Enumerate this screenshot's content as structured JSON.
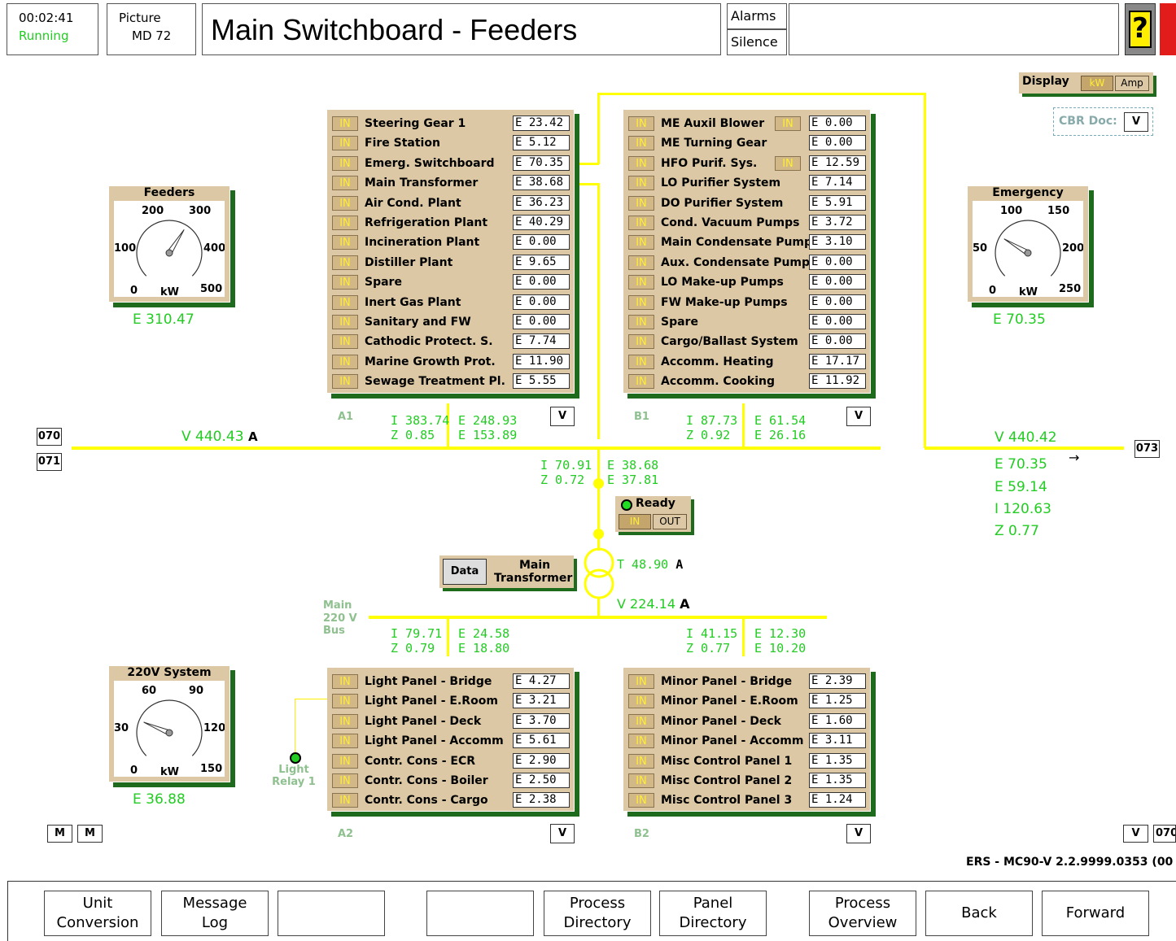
{
  "header": {
    "time": "00:02:41",
    "state": "Running",
    "picture_label": "Picture",
    "picture_id": "MD 72",
    "title": "Main Switchboard - Feeders",
    "alarms_label": "Alarms",
    "silence_label": "Silence",
    "help_glyph": "?"
  },
  "display": {
    "label": "Display",
    "kw": "kW",
    "amp": "Amp",
    "cbr_label": "CBR Doc:",
    "cbr_value": "V"
  },
  "in_label": "IN",
  "panel_a1": {
    "id": "A1",
    "rows": [
      {
        "label": "Steering Gear 1",
        "value": "E 23.42"
      },
      {
        "label": "Fire Station",
        "value": "E 5.12"
      },
      {
        "label": "Emerg. Switchboard",
        "value": "E 70.35"
      },
      {
        "label": "Main Transformer",
        "value": "E 38.68"
      },
      {
        "label": "Air Cond. Plant",
        "value": "E 36.23"
      },
      {
        "label": "Refrigeration Plant",
        "value": "E 40.29"
      },
      {
        "label": "Incineration Plant",
        "value": "E 0.00"
      },
      {
        "label": "Distiller Plant",
        "value": "E 9.65"
      },
      {
        "label": "Spare",
        "value": "E 0.00"
      },
      {
        "label": "Inert Gas Plant",
        "value": "E 0.00"
      },
      {
        "label": "Sanitary and FW",
        "value": "E 0.00"
      },
      {
        "label": "Cathodic Protect. S.",
        "value": "E 7.74"
      },
      {
        "label": "Marine Growth Prot.",
        "value": "E 11.90"
      },
      {
        "label": "Sewage Treatment Pl.",
        "value": "E 5.55"
      }
    ],
    "i": "I 383.74",
    "z": "Z 0.85",
    "e1": "E 248.93",
    "e2": "E 153.89",
    "v_btn": "V"
  },
  "panel_b1": {
    "id": "B1",
    "rows": [
      {
        "label": "ME Auxil Blower",
        "value": "E 0.00",
        "extra_in": true
      },
      {
        "label": "ME Turning Gear",
        "value": "E 0.00"
      },
      {
        "label": "HFO Purif. Sys.",
        "value": "E 12.59",
        "extra_in": true
      },
      {
        "label": "LO Purifier System",
        "value": "E 7.14"
      },
      {
        "label": "DO Purifier System",
        "value": "E 5.91"
      },
      {
        "label": "Cond. Vacuum Pumps",
        "value": "E 3.72"
      },
      {
        "label": "Main Condensate Pump",
        "value": "E 3.10"
      },
      {
        "label": "Aux. Condensate Pump",
        "value": "E 0.00"
      },
      {
        "label": "LO Make-up Pumps",
        "value": "E 0.00"
      },
      {
        "label": "FW Make-up Pumps",
        "value": "E 0.00"
      },
      {
        "label": "Spare",
        "value": "E 0.00"
      },
      {
        "label": "Cargo/Ballast System",
        "value": "E 0.00"
      },
      {
        "label": "Accomm. Heating",
        "value": "E 17.17"
      },
      {
        "label": "Accomm. Cooking",
        "value": "E 11.92"
      }
    ],
    "i": "I 87.73",
    "z": "Z 0.92",
    "e1": "E 61.54",
    "e2": "E 26.16",
    "v_btn": "V"
  },
  "panel_a2": {
    "id": "A2",
    "rows": [
      {
        "label": "Light Panel - Bridge",
        "value": "E 4.27"
      },
      {
        "label": "Light Panel - E.Room",
        "value": "E 3.21"
      },
      {
        "label": "Light Panel - Deck",
        "value": "E 3.70"
      },
      {
        "label": "Light Panel - Accomm",
        "value": "E 5.61"
      },
      {
        "label": "Contr.  Cons  - ECR",
        "value": "E 2.90"
      },
      {
        "label": "Contr.  Cons  - Boiler",
        "value": "E 2.50"
      },
      {
        "label": "Contr.  Cons  - Cargo",
        "value": "E 2.38"
      }
    ],
    "i": "I 79.71",
    "z": "Z 0.79",
    "e1": "E 24.58",
    "e2": "E 18.80",
    "v_btn": "V"
  },
  "panel_b2": {
    "id": "B2",
    "rows": [
      {
        "label": "Minor Panel - Bridge",
        "value": "E 2.39"
      },
      {
        "label": "Minor Panel - E.Room",
        "value": "E 1.25"
      },
      {
        "label": "Minor Panel - Deck",
        "value": "E 1.60"
      },
      {
        "label": "Minor Panel - Accomm",
        "value": "E 3.11"
      },
      {
        "label": "Misc Control Panel 1",
        "value": "E 1.35"
      },
      {
        "label": "Misc Control Panel 2",
        "value": "E 1.35"
      },
      {
        "label": "Misc Control Panel 3",
        "value": "E 1.24"
      }
    ],
    "i": "I 41.15",
    "z": "Z 0.77",
    "e1": "E 12.30",
    "e2": "E 10.20",
    "v_btn": "V"
  },
  "gauges": {
    "feeders": {
      "title": "Feeders",
      "ticks": [
        "200",
        "300",
        "100",
        "400",
        "0",
        "500"
      ],
      "unit": "kW",
      "reading": "E 310.47",
      "value_fraction": 0.62
    },
    "emergency": {
      "title": "Emergency",
      "ticks": [
        "100",
        "150",
        "50",
        "200",
        "0",
        "250"
      ],
      "unit": "kW",
      "reading": "E 70.35",
      "value_fraction": 0.28
    },
    "sys220": {
      "title": "220V System",
      "ticks": [
        "60",
        "90",
        "30",
        "120",
        "0",
        "150"
      ],
      "unit": "kW",
      "reading": "E 36.88",
      "value_fraction": 0.25
    }
  },
  "bus": {
    "left_tag_top": "070",
    "left_tag_bottom": "071",
    "main_v": "V 440.43",
    "main_v_unit": "A",
    "right_tag": "073",
    "right_v": "V 440.42",
    "right_e1": "E 70.35",
    "right_e2": "E 59.14",
    "right_i": "I 120.63",
    "right_z": "Z 0.77",
    "arrow": "→"
  },
  "transformer": {
    "i": "I 70.91",
    "z": "Z 0.72",
    "e1": "E 38.68",
    "e2": "E 37.81",
    "ready": "Ready",
    "in": "IN",
    "out": "OUT",
    "data_btn": "Data",
    "label_line1": "Main",
    "label_line2": "Transformer",
    "t_value": "T 48.90",
    "t_unit": "A",
    "v_220": "V 224.14",
    "v_220_unit": "A",
    "bus_label_1": "Main",
    "bus_label_2": "220 V",
    "bus_label_3": "Bus"
  },
  "light_relay": {
    "line1": "Light",
    "line2": "Relay 1"
  },
  "misc": {
    "m1": "M",
    "m2": "M",
    "v_right": "V",
    "tag_right": "070",
    "version": "ERS - MC90-V 2.2.9999.0353 (00"
  },
  "bottom": {
    "b1": [
      "Unit",
      "Conversion"
    ],
    "b2": [
      "Message",
      "Log"
    ],
    "b3": "",
    "b4": "",
    "b5": [
      "Process",
      "Directory"
    ],
    "b6": [
      "Panel",
      "Directory"
    ],
    "b7": [
      "Process",
      "Overview"
    ],
    "b8": "Back",
    "b9": "Forward"
  }
}
